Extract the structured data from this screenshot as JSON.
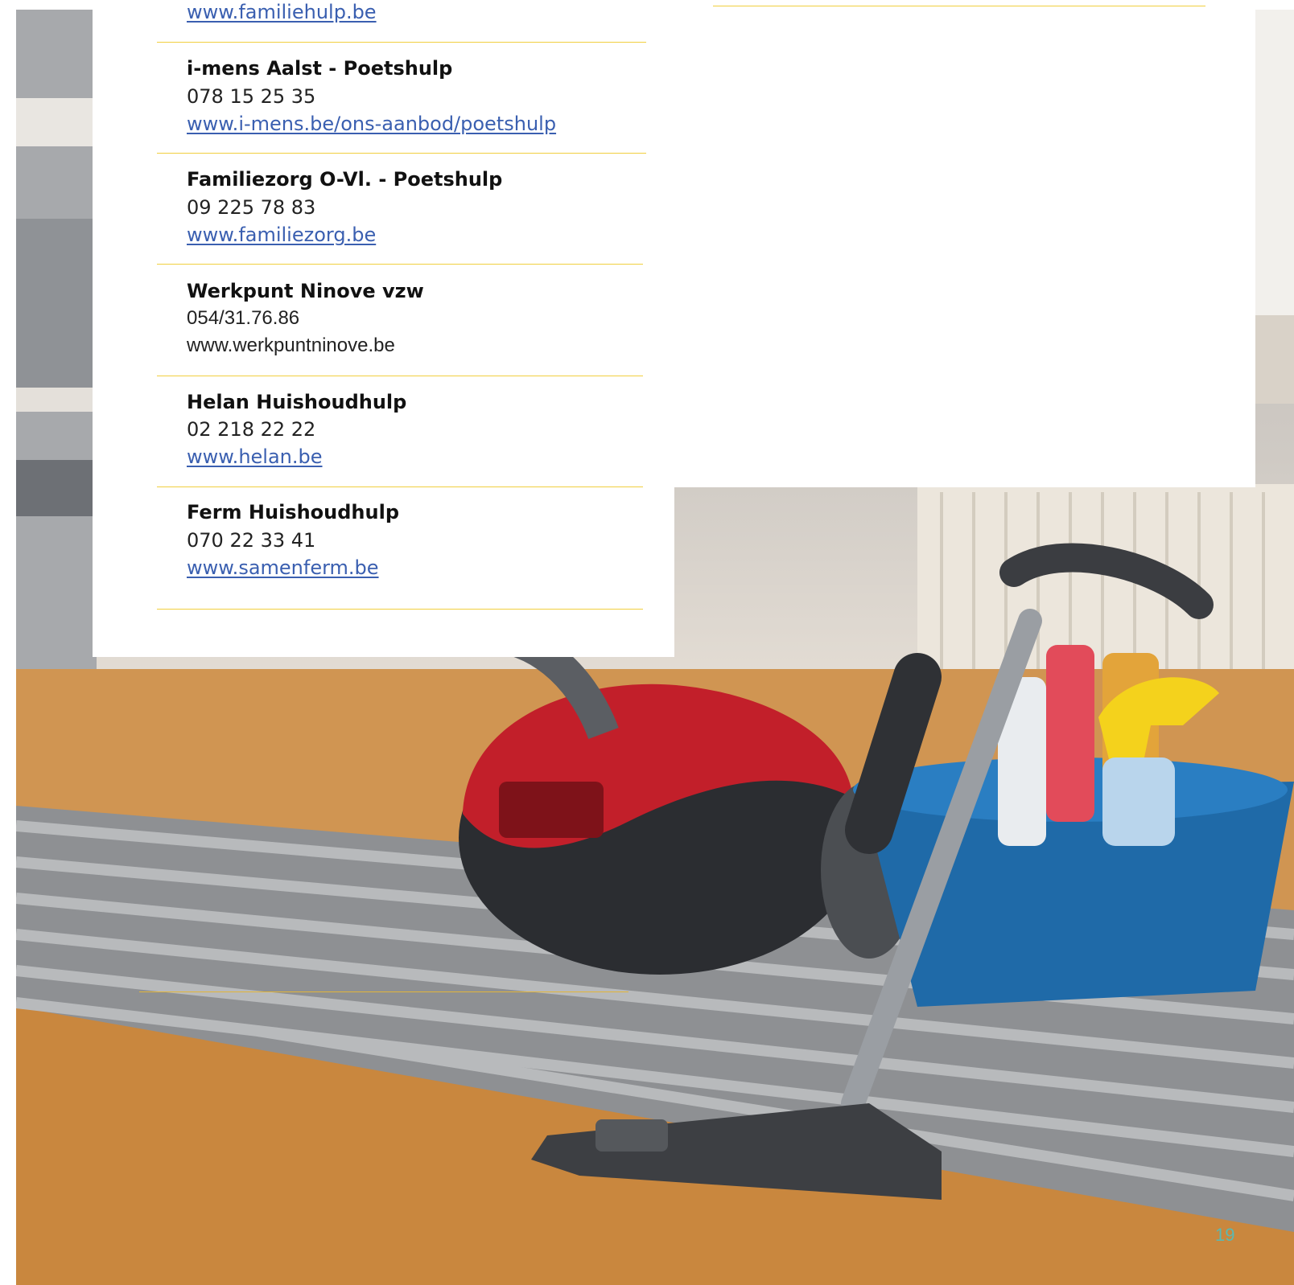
{
  "entries": [
    {
      "name": "",
      "phone": "",
      "url": "www.familiehulp.be",
      "url_is_link": true
    },
    {
      "name": "i-mens Aalst - Poetshulp",
      "phone": "078 15 25 35",
      "url": "www.i-mens.be/ons-aanbod/poetshulp",
      "url_is_link": true
    },
    {
      "name": "Familiezorg O-Vl. - Poetshulp",
      "phone": "09 225 78 83",
      "url": "www.familiezorg.be",
      "url_is_link": true
    },
    {
      "name": "Werkpunt Ninove vzw",
      "phone": "054/31.76.86",
      "url": "www.werkpuntninove.be",
      "url_is_link": false
    },
    {
      "name": "Helan Huishoudhulp",
      "phone": "02 218 22 22",
      "url": "www.helan.be",
      "url_is_link": true
    },
    {
      "name": "Ferm Huishoudhulp",
      "phone": "070 22 33 41",
      "url": "www.samenferm.be",
      "url_is_link": true
    }
  ],
  "page_number": "19",
  "colors": {
    "rule": "#f1cf3f",
    "link": "#3a5fb0",
    "page_number": "#5ab9b3"
  }
}
